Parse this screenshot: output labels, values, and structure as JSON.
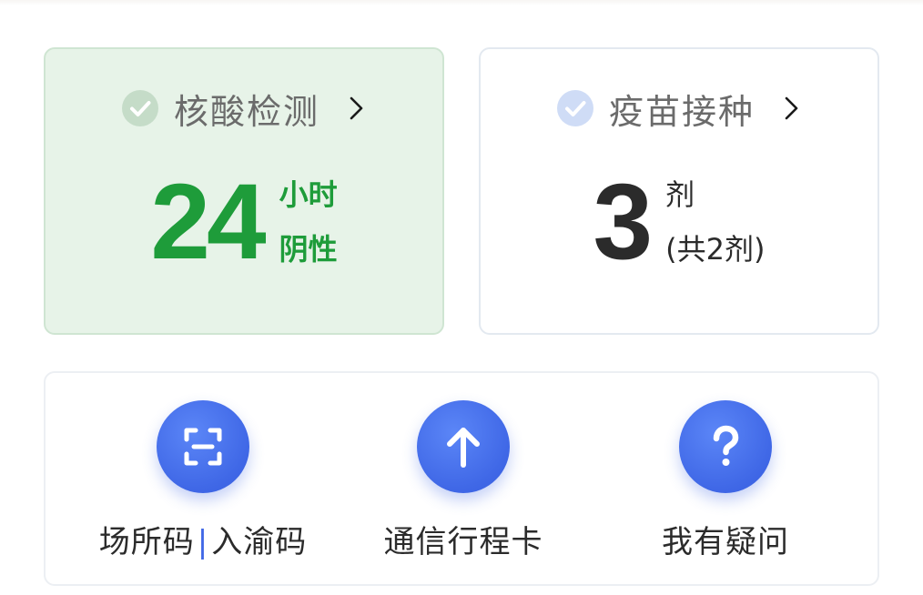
{
  "nucleic_card": {
    "title": "核酸检测",
    "value": "24",
    "unit_line1": "小时",
    "unit_line2": "阴性",
    "status_color": "#1e9c3a",
    "icon": "check-circle-icon"
  },
  "vaccine_card": {
    "title": "疫苗接种",
    "value": "3",
    "unit_line1": "剂",
    "unit_line2": "(共2剂)",
    "icon": "check-circle-icon"
  },
  "actions": [
    {
      "label_part1": "场所码",
      "separator": "|",
      "label_part2": "入渝码",
      "icon": "scan-icon"
    },
    {
      "label": "通信行程卡",
      "icon": "arrow-up-icon"
    },
    {
      "label": "我有疑问",
      "icon": "question-icon"
    }
  ],
  "colors": {
    "accent_blue": "#3f67e6",
    "success_green": "#1e9c3a"
  }
}
